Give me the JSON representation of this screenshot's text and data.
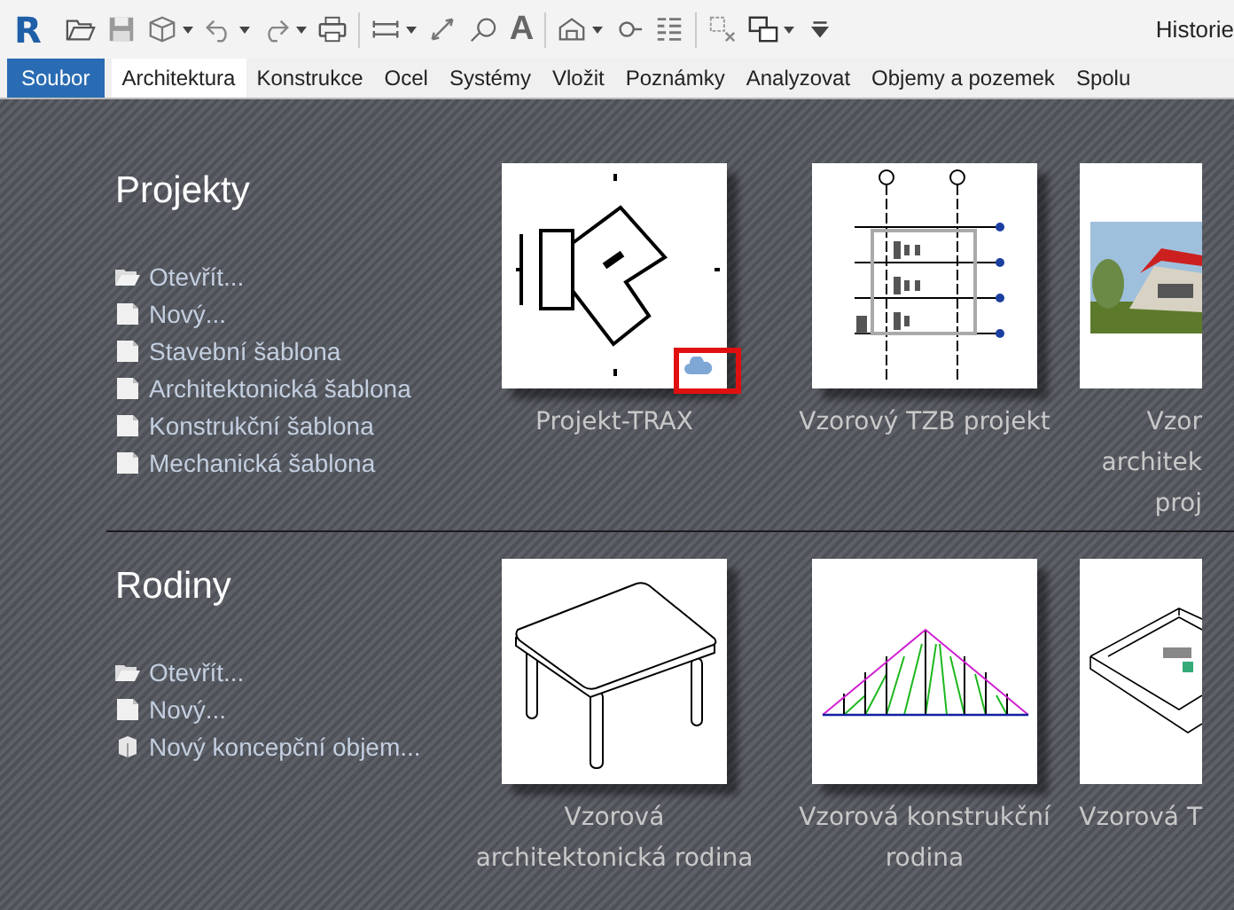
{
  "toolbar": {
    "logo": "R",
    "text_tool": "A",
    "history": "Historie"
  },
  "tabs": [
    {
      "label": "Soubor",
      "kind": "file",
      "selected": false
    },
    {
      "label": "Architektura",
      "kind": "tab",
      "selected": true
    },
    {
      "label": "Konstrukce",
      "kind": "tab",
      "selected": false
    },
    {
      "label": "Ocel",
      "kind": "tab",
      "selected": false
    },
    {
      "label": "Systémy",
      "kind": "tab",
      "selected": false
    },
    {
      "label": "Vložit",
      "kind": "tab",
      "selected": false
    },
    {
      "label": "Poznámky",
      "kind": "tab",
      "selected": false
    },
    {
      "label": "Analyzovat",
      "kind": "tab",
      "selected": false
    },
    {
      "label": "Objemy a pozemek",
      "kind": "tab",
      "selected": false
    },
    {
      "label": "Spolu",
      "kind": "tab",
      "selected": false
    }
  ],
  "sections": [
    {
      "title": "Projekty",
      "links": [
        {
          "label": "Otevřít...",
          "kind": "folder"
        },
        {
          "label": "Nový...",
          "kind": "document"
        },
        {
          "label": "Stavební šablona",
          "kind": "document"
        },
        {
          "label": "Architektonická šablona",
          "kind": "document"
        },
        {
          "label": "Konstrukční šablona",
          "kind": "document"
        },
        {
          "label": "Mechanická šablona",
          "kind": "document"
        }
      ],
      "thumbnails": [
        {
          "caption_lines": [
            "Projekt-TRAX"
          ],
          "kind": "plan",
          "cloud": true,
          "highlighted": true
        },
        {
          "caption_lines": [
            "Vzorový TZB projekt"
          ],
          "kind": "section",
          "cloud": false,
          "highlighted": false
        },
        {
          "caption_lines": [
            "Vzor",
            "architek",
            "proj"
          ],
          "cloud": false,
          "highlighted": false
        }
      ]
    },
    {
      "title": "Rodiny",
      "links": [
        {
          "label": "Otevřít...",
          "kind": "folder"
        },
        {
          "label": "Nový...",
          "kind": "document"
        },
        {
          "label": "Nový koncepční objem...",
          "kind": "mass"
        }
      ],
      "thumbnails": [
        {
          "caption_lines": [
            "Vzorová",
            "architektonická rodina"
          ],
          "kind": "table",
          "cloud": false,
          "highlighted": false
        },
        {
          "caption_lines": [
            "Vzorová konstrukční",
            "rodina"
          ],
          "kind": "truss",
          "cloud": false,
          "highlighted": false
        },
        {
          "caption_lines": [
            "Vzorová T"
          ],
          "kind": "slab",
          "cloud": false,
          "highlighted": false
        }
      ]
    }
  ]
}
